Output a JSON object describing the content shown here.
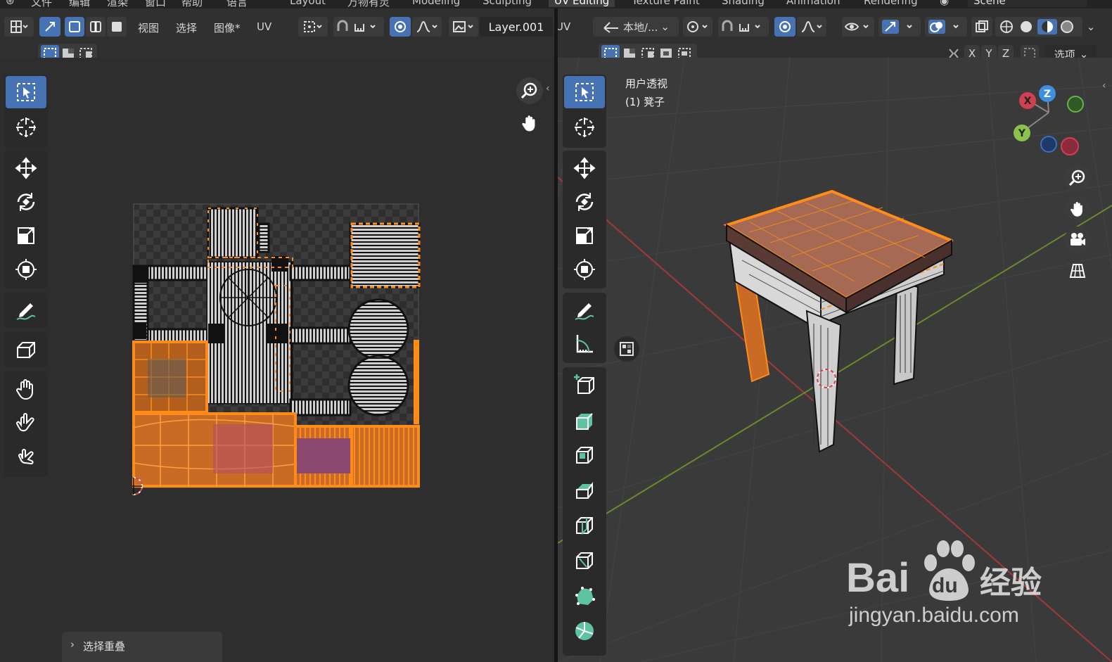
{
  "menu": {
    "items": [
      "文件",
      "编辑",
      "渲染",
      "窗口",
      "帮助",
      "语言"
    ],
    "workspaces": [
      "Layout",
      "万物有灵",
      "Modeling",
      "Sculpting",
      "UV Editing",
      "Texture Paint",
      "Shading",
      "Animation",
      "Rendering"
    ],
    "active_workspace": "UV Editing",
    "scene": "Scene"
  },
  "uv_header": {
    "menus": [
      "视图",
      "选择",
      "图像*",
      "UV"
    ],
    "image_name": "Layer.001"
  },
  "viewport_header": {
    "uv_label": "UV",
    "orientation": "本地/...",
    "axes": [
      "X",
      "Y",
      "Z"
    ],
    "options": "选项"
  },
  "viewport_overlay": {
    "view_name": "用户透视",
    "object_name": "(1) 凳子"
  },
  "gizmo": {
    "x": "X",
    "y": "Y",
    "z": "Z"
  },
  "operator_panel": {
    "label": "选择重叠"
  },
  "watermark": {
    "brand": "Bai",
    "brand2": "du",
    "cn": "经验",
    "url": "jingyan.baidu.com"
  },
  "colors": {
    "accent": "#4772b3",
    "selection": "#ff8c1a",
    "uv_bg": "#2e2e2e",
    "viewport_bg": "#3a3a3a"
  }
}
